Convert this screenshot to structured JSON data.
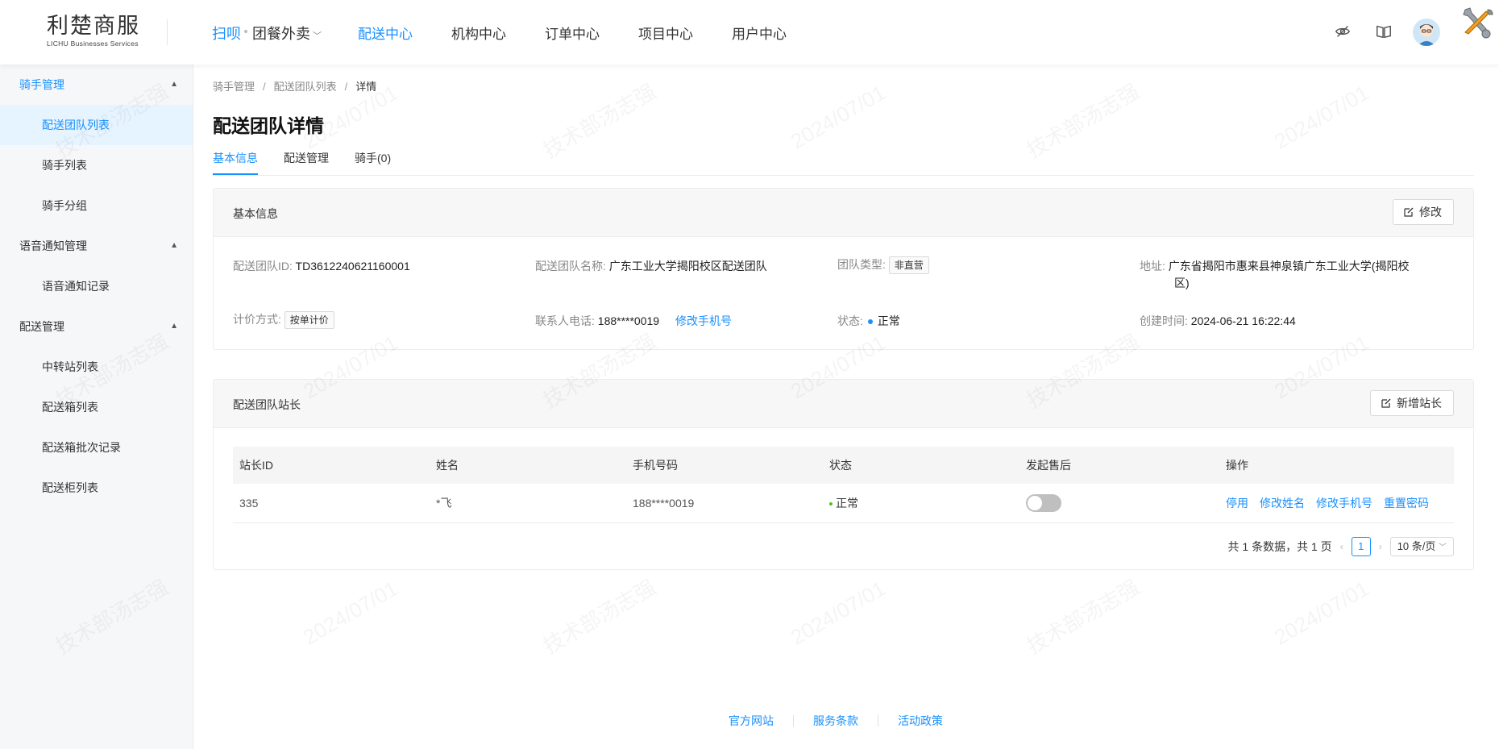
{
  "app": {
    "logo_cn": "利楚商服",
    "logo_en": "LICHU Businesses Services",
    "brand_primary": "扫呗",
    "brand_secondary": "团餐外卖"
  },
  "nav": {
    "items": [
      {
        "label": "配送中心",
        "active": true
      },
      {
        "label": "机构中心",
        "active": false
      },
      {
        "label": "订单中心",
        "active": false
      },
      {
        "label": "项目中心",
        "active": false
      },
      {
        "label": "用户中心",
        "active": false
      }
    ]
  },
  "header_icons": [
    "eye-off-icon",
    "book-icon",
    "avatar",
    "tools-icon"
  ],
  "sidebar": {
    "groups": [
      {
        "label": "骑手管理",
        "items": [
          "配送团队列表",
          "骑手列表",
          "骑手分组"
        ]
      },
      {
        "label": "语音通知管理",
        "items": [
          "语音通知记录"
        ]
      },
      {
        "label": "配送管理",
        "items": [
          "中转站列表",
          "配送箱列表",
          "配送箱批次记录",
          "配送柜列表"
        ]
      }
    ],
    "active_item": "配送团队列表"
  },
  "breadcrumb": [
    "骑手管理",
    "配送团队列表",
    "详情"
  ],
  "page_title": "配送团队详情",
  "tabs": [
    "基本信息",
    "配送管理",
    "骑手(0)"
  ],
  "basic_info": {
    "title": "基本信息",
    "edit_label": "修改",
    "team_id_label": "配送团队ID:",
    "team_id": "TD3612240621160001",
    "team_name_label": "配送团队名称:",
    "team_name": "广东工业大学揭阳校区配送团队",
    "team_type_label": "团队类型:",
    "team_type": "非直营",
    "address_label": "地址:",
    "address_line1": "广东省揭阳市惠来县神泉镇广东工业大学(揭阳校",
    "address_line2": "区)",
    "pricing_label": "计价方式:",
    "pricing": "按单计价",
    "phone_label": "联系人电话:",
    "phone": "188****0019",
    "change_phone": "修改手机号",
    "status_label": "状态:",
    "status": "正常",
    "created_label": "创建时间:",
    "created": "2024-06-21 16:22:44"
  },
  "managers": {
    "title": "配送团队站长",
    "add_label": "新增站长",
    "columns": [
      "站长ID",
      "姓名",
      "手机号码",
      "状态",
      "发起售后",
      "操作"
    ],
    "rows": [
      {
        "id": "335",
        "name": "*飞",
        "phone": "188****0019",
        "status": "正常",
        "after_sale_enabled": false,
        "ops": [
          "停用",
          "修改姓名",
          "修改手机号",
          "重置密码"
        ]
      }
    ],
    "pager": {
      "summary": "共 1 条数据，共 1 页",
      "current": "1",
      "page_size": "10 条/页"
    }
  },
  "footer": [
    "官方网站",
    "服务条款",
    "活动政策"
  ],
  "watermark": {
    "name": "技术部汤志强",
    "date": "2024/07/01"
  },
  "colors": {
    "accent": "#1890ff",
    "status_dot": "#52c41a"
  }
}
